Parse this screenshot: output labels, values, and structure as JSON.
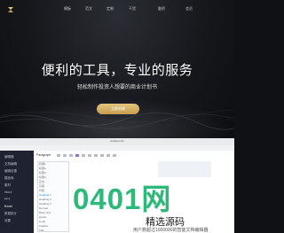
{
  "nav": {
    "items": [
      {
        "label": "模板"
      },
      {
        "label": "范文"
      },
      {
        "label": "定制"
      },
      {
        "label": "干货"
      },
      {
        "label": "融资"
      },
      {
        "label": "会员"
      }
    ]
  },
  "hero": {
    "title": "便利的工具，专业的服务",
    "subtitle": "轻松制作投资人想要的商业计划书",
    "cta_label": "立即创建"
  },
  "browser": {
    "url": "xiaobai.com"
  },
  "sidebar": {
    "items": [
      {
        "label": "编辑器"
      },
      {
        "label": "文档编辑"
      },
      {
        "label": "编辑设置"
      },
      {
        "label": "模板库"
      },
      {
        "label": "素材"
      },
      {
        "label": "Word"
      },
      {
        "label": "PPT"
      },
      {
        "label": "Excel"
      },
      {
        "label": "数据统计"
      },
      {
        "label": "设置"
      }
    ]
  },
  "editor": {
    "format_label": "Paragraph",
    "list_items": [
      {
        "label": "标题1"
      },
      {
        "label": "标题2"
      },
      {
        "label": "标题3"
      },
      {
        "label": "标题4"
      },
      {
        "label": "正文"
      },
      {
        "label": "引用"
      },
      {
        "label": "代码"
      },
      {
        "label": "Heading 1"
      },
      {
        "label": "Heading 2"
      },
      {
        "label": "Heading 3"
      },
      {
        "label": "Normal"
      },
      {
        "label": "Body Text"
      },
      {
        "label": "Quote"
      },
      {
        "label": "Code"
      },
      {
        "label": "Caption"
      },
      {
        "label": "Title"
      }
    ]
  },
  "watermark": {
    "main": "0401网",
    "line1": "精选源码",
    "line2": "用户数超过1000000的智能文档编辑器"
  },
  "colors": {
    "accent_gold": "#e8c37a",
    "sidebar_bg": "#1f2230",
    "watermark_green": "#2eb87a"
  }
}
